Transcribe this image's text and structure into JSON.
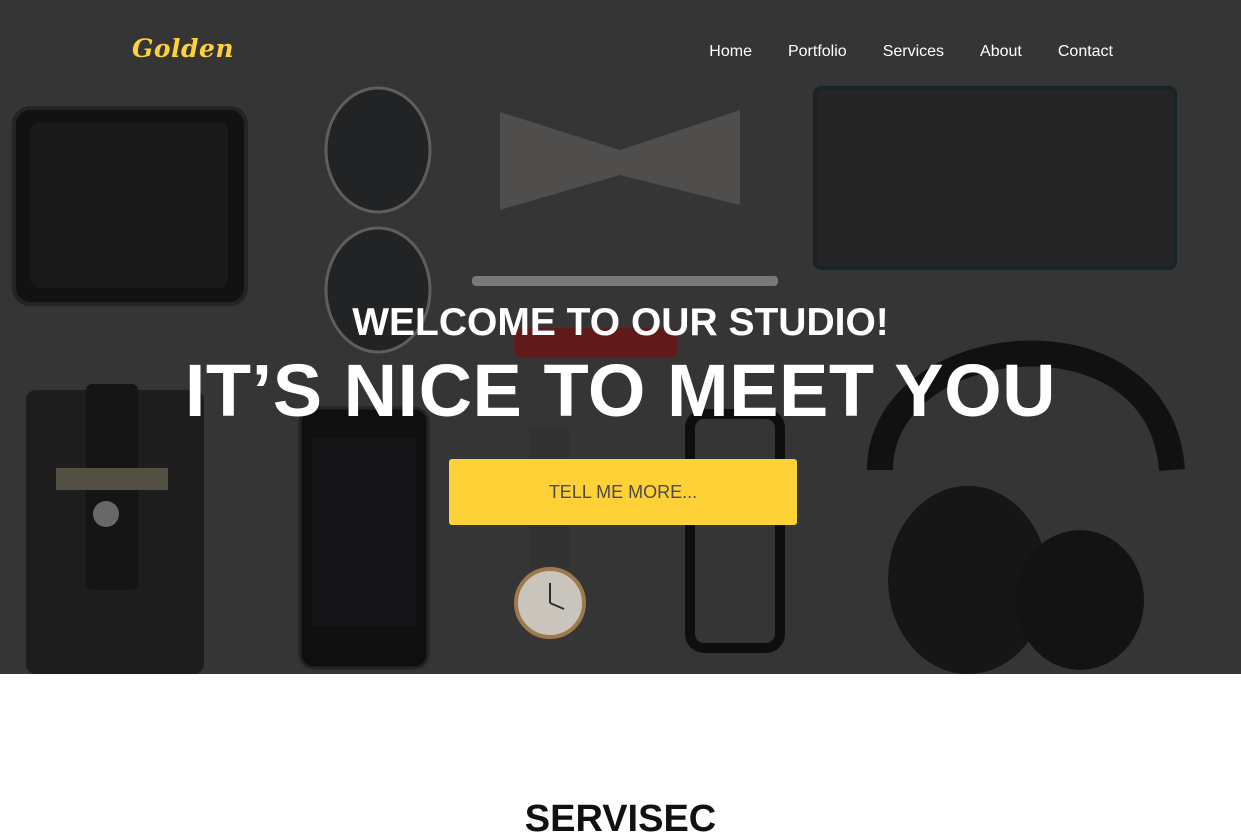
{
  "brand": {
    "logo": "Golden",
    "accent": "#fed136"
  },
  "nav": {
    "items": [
      {
        "label": "Home"
      },
      {
        "label": "Portfolio"
      },
      {
        "label": "Services"
      },
      {
        "label": "About"
      },
      {
        "label": "Contact"
      }
    ]
  },
  "hero": {
    "lead": "WELCOME TO OUR STUDIO!",
    "heading": "IT’S NICE TO MEET YOU",
    "cta_label": "TELL ME MORE..."
  },
  "services": {
    "title": "SERVISEC"
  }
}
